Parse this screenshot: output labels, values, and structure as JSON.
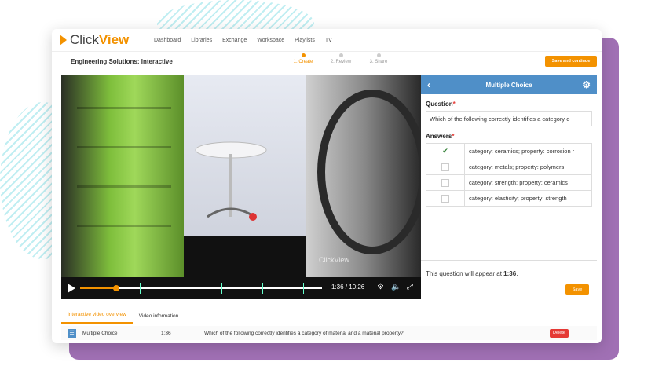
{
  "app": {
    "logo_left": "Click",
    "logo_right": "View"
  },
  "nav": [
    "Dashboard",
    "Libraries",
    "Exchange",
    "Workspace",
    "Playlists",
    "TV"
  ],
  "header": {
    "title": "Engineering Solutions: Interactive",
    "save_continue": "Save and continue"
  },
  "steps": [
    {
      "label": "1. Create",
      "active": true
    },
    {
      "label": "2. Review",
      "active": false
    },
    {
      "label": "3. Share",
      "active": false
    }
  ],
  "video": {
    "watermark": "ClickView",
    "time": "1:36 / 10:26",
    "progress": 0.15
  },
  "question_panel": {
    "title": "Multiple Choice",
    "question_label": "Question",
    "required_mark": "*",
    "question_value": "Which of the following correctly identifies a category o",
    "answers_label": "Answers",
    "answers": [
      {
        "text": "category: ceramics; property: corrosion r",
        "correct": true
      },
      {
        "text": "category: metals; property: polymers",
        "correct": false
      },
      {
        "text": "category: strength; property: ceramics",
        "correct": false
      },
      {
        "text": "category: elasticity; property: strength",
        "correct": false
      }
    ],
    "appear_text": "This question will appear at ",
    "appear_time": "1:36",
    "save": "Save"
  },
  "tabs": [
    {
      "label": "Interactive video overview",
      "active": true
    },
    {
      "label": "Video information",
      "active": false
    }
  ],
  "list": [
    {
      "type": "Multiple Choice",
      "time": "1:36",
      "question": "Which of the following correctly identifies a category of material and a material property?",
      "delete": "Delete"
    }
  ],
  "colors": {
    "accent": "#f39200",
    "header_blue": "#4f8fc8",
    "danger": "#e53935",
    "frame_purple": "#a070b4"
  }
}
